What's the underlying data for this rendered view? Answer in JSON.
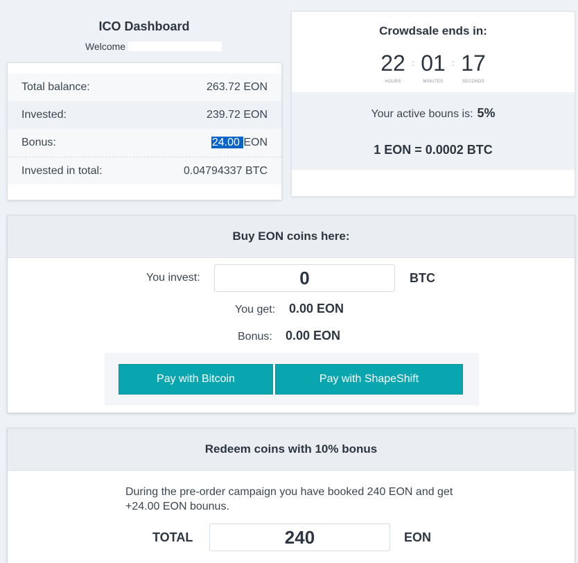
{
  "dashboard": {
    "title": "ICO Dashboard",
    "welcome": "Welcome",
    "rows": [
      {
        "label": "Total balance:",
        "value": "263.72 EON"
      },
      {
        "label": "Invested:",
        "value": "239.72 EON"
      },
      {
        "label": "Bonus:",
        "value_highlight": "24.00 ",
        "value_rest": "EON"
      },
      {
        "label": "Invested in total:",
        "value": "0.04794337 BTC"
      }
    ]
  },
  "crowdsale": {
    "title": "Crowdsale ends in:",
    "hours": "22",
    "minutes": "01",
    "seconds": "17",
    "hours_label": "HOURS",
    "minutes_label": "MINUTES",
    "seconds_label": "SECONDS",
    "separator": ":",
    "bonus_label": "Your active bouns is:",
    "bonus_value": "5%",
    "rate": "1 EON = 0.0002 BTC"
  },
  "buy": {
    "title": "Buy EON coins here:",
    "invest_label": "You invest:",
    "invest_value": "0",
    "invest_unit": "BTC",
    "get_label": "You get:",
    "get_value": "0.00 EON",
    "bonus_label": "Bonus:",
    "bonus_value": "0.00 EON",
    "pay_bitcoin": "Pay with Bitcoin",
    "pay_shapeshift": "Pay with ShapeShift"
  },
  "redeem": {
    "title": "Redeem coins with 10% bonus",
    "text": "During the pre-order campaign you have booked 240 EON and get +24.00 EON bounus.",
    "total_label": "TOTAL",
    "total_value": "240",
    "total_unit": "EON"
  },
  "colors": {
    "accent": "#0aa6b0",
    "highlight": "#0a64c8",
    "background": "#eef1f6"
  }
}
